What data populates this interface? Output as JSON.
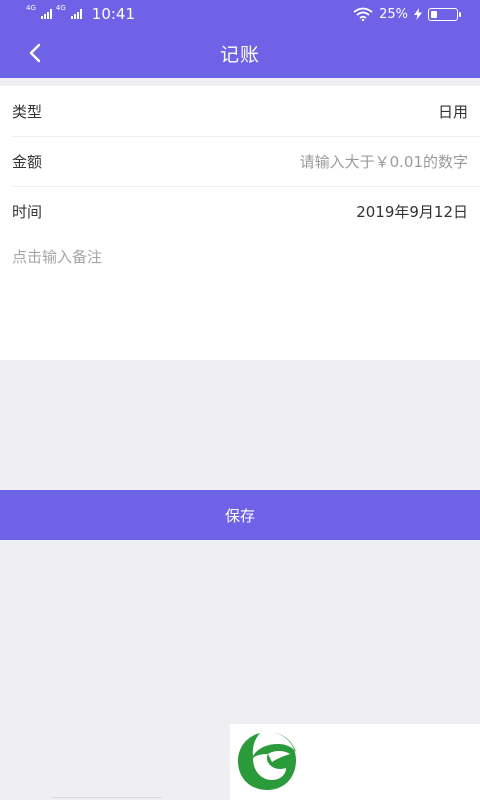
{
  "status": {
    "time": "10:41",
    "net1": "4G",
    "net2": "4G",
    "battery_text": "25%",
    "battery_level": 0.25
  },
  "nav": {
    "title": "记账"
  },
  "form": {
    "type_label": "类型",
    "type_value": "日用",
    "amount_label": "金额",
    "amount_placeholder": "请输入大于￥0.01的数字",
    "date_label": "时间",
    "date_value": "2019年9月12日",
    "note_placeholder": "点击输入备注"
  },
  "actions": {
    "save_label": "保存"
  },
  "colors": {
    "accent": "#6e63e6",
    "page_bg": "#efeef3",
    "logo_green": "#2a9a3a"
  }
}
